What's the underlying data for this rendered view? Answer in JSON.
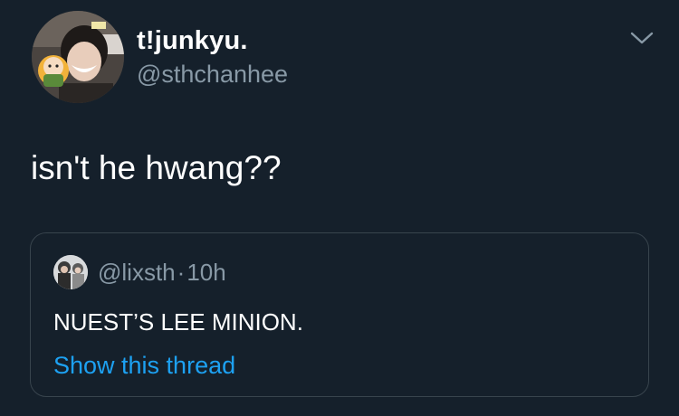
{
  "tweet": {
    "display_name": "t!junkyu.",
    "handle": "@sthchanhee",
    "text": "isn't he hwang??",
    "more_icon": "chevron-down-icon"
  },
  "quoted_tweet": {
    "handle": "@lixsth",
    "separator": "·",
    "time": "10h",
    "text": "NUEST’S LEE MINION.",
    "thread_link": "Show this thread"
  },
  "colors": {
    "background": "#15202b",
    "primary_text": "#ffffff",
    "secondary_text": "#8899a6",
    "link": "#1da1f2",
    "border": "#38444d"
  }
}
